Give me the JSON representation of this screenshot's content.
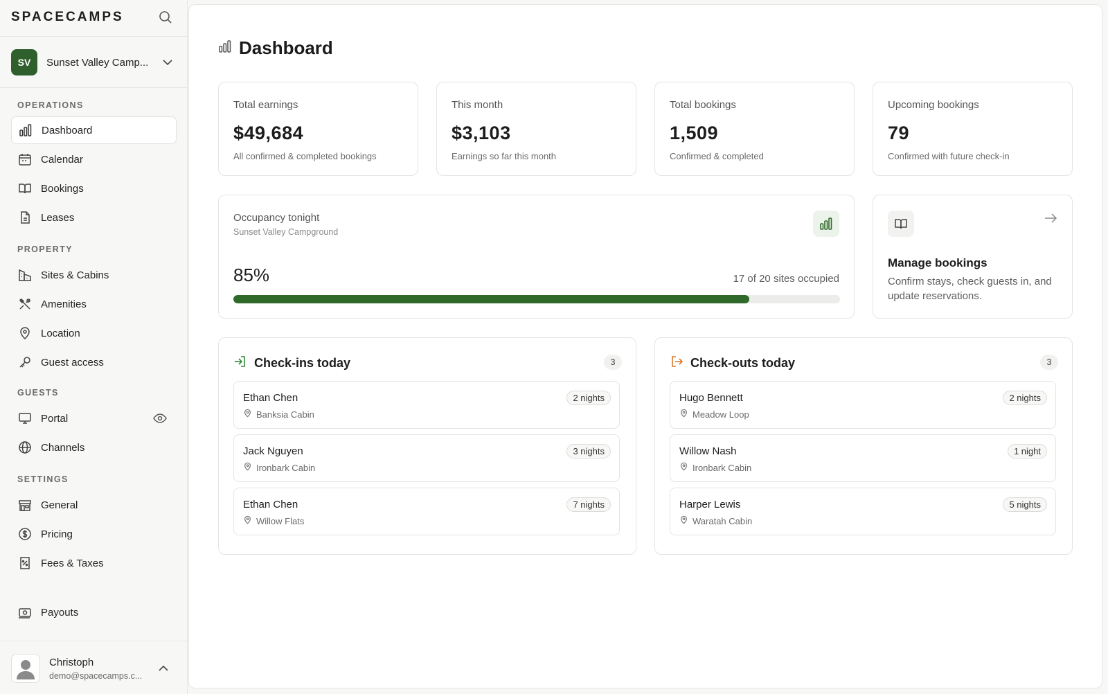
{
  "brand": {
    "name": "SPACECAMPS"
  },
  "org": {
    "initials": "SV",
    "name": "Sunset Valley Camp..."
  },
  "sidebar": {
    "sections": {
      "operations": "OPERATIONS",
      "property": "PROPERTY",
      "guests": "GUESTS",
      "settings": "SETTINGS"
    },
    "items": {
      "dashboard": "Dashboard",
      "calendar": "Calendar",
      "bookings": "Bookings",
      "leases": "Leases",
      "sites": "Sites & Cabins",
      "amenities": "Amenities",
      "location": "Location",
      "guest_access": "Guest access",
      "portal": "Portal",
      "channels": "Channels",
      "general": "General",
      "pricing": "Pricing",
      "fees": "Fees & Taxes",
      "payouts": "Payouts"
    },
    "active": "dashboard"
  },
  "user": {
    "name": "Christoph",
    "email": "demo@spacecamps.c..."
  },
  "page": {
    "title": "Dashboard"
  },
  "stats": [
    {
      "label": "Total earnings",
      "value": "$49,684",
      "sub": "All confirmed & completed bookings"
    },
    {
      "label": "This month",
      "value": "$3,103",
      "sub": "Earnings so far this month"
    },
    {
      "label": "Total bookings",
      "value": "1,509",
      "sub": "Confirmed & completed"
    },
    {
      "label": "Upcoming bookings",
      "value": "79",
      "sub": "Confirmed with future check-in"
    }
  ],
  "occupancy": {
    "title": "Occupancy tonight",
    "subtitle": "Sunset Valley Campground",
    "percent_label": "85%",
    "percent": 0.85,
    "count_text": "17 of 20 sites occupied"
  },
  "manage": {
    "title": "Manage bookings",
    "description": "Confirm stays, check guests in, and update reservations."
  },
  "checkins": {
    "title": "Check-ins today",
    "count": "3",
    "rows": [
      {
        "name": "Ethan Chen",
        "location": "Banksia Cabin",
        "nights": "2 nights"
      },
      {
        "name": "Jack Nguyen",
        "location": "Ironbark Cabin",
        "nights": "3 nights"
      },
      {
        "name": "Ethan Chen",
        "location": "Willow Flats",
        "nights": "7 nights"
      }
    ]
  },
  "checkouts": {
    "title": "Check-outs today",
    "count": "3",
    "rows": [
      {
        "name": "Hugo Bennett",
        "location": "Meadow Loop",
        "nights": "2 nights"
      },
      {
        "name": "Willow Nash",
        "location": "Ironbark Cabin",
        "nights": "1 night"
      },
      {
        "name": "Harper Lewis",
        "location": "Waratah Cabin",
        "nights": "5 nights"
      }
    ]
  },
  "colors": {
    "accent": "#2f6a2b",
    "checkout": "#d9772a",
    "avatar": "#2f5f2c"
  },
  "icons": {
    "search": "search-icon",
    "chevron": "chevron-down-icon",
    "dashboard": "bar-chart-icon",
    "calendar": "calendar-icon",
    "bookings": "book-open-icon",
    "leases": "document-icon",
    "sites": "building-icon",
    "amenities": "tools-icon",
    "location": "map-pin-icon",
    "guest_access": "key-icon",
    "portal": "monitor-icon",
    "channels": "globe-icon",
    "general": "storefront-icon",
    "pricing": "dollar-circle-icon",
    "fees": "receipt-icon",
    "payouts": "banknote-icon",
    "eye": "eye-icon",
    "arrow": "arrow-right-icon",
    "checkin": "log-in-icon",
    "checkout": "log-out-icon"
  }
}
